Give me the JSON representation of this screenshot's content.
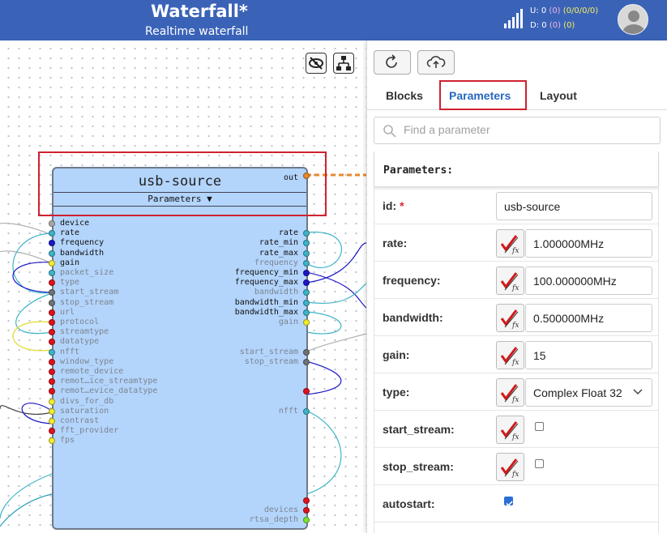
{
  "header": {
    "title": "Waterfall*",
    "subtitle": "Realtime waterfall",
    "stats_up": {
      "label": "U: 0",
      "paren": "(0)",
      "detail": "(0/0/0/0)"
    },
    "stats_down": {
      "label": "D: 0",
      "paren": "(0)",
      "detail": "(0)"
    }
  },
  "canvas": {
    "toolbar_icons": [
      "eye-slash-icon",
      "sitemap-icon"
    ],
    "block": {
      "title": "usb-source",
      "params_label": "Parameters ▼",
      "output_label": "out",
      "inputs": [
        {
          "label": "device",
          "color": "#a7a7a7",
          "state": "active"
        },
        {
          "label": "rate",
          "color": "#3eb3c6",
          "state": "active"
        },
        {
          "label": "frequency",
          "color": "#1b16c7",
          "state": "active"
        },
        {
          "label": "bandwidth",
          "color": "#3eb3c6",
          "state": "active"
        },
        {
          "label": "gain",
          "color": "#f2ec2e",
          "state": "active"
        },
        {
          "label": "packet_size",
          "color": "#3eb3c6",
          "state": "dim"
        },
        {
          "label": "type",
          "color": "#e0121d",
          "state": "dim"
        },
        {
          "label": "start_stream",
          "color": "#6e7274",
          "state": "dim"
        },
        {
          "label": "stop_stream",
          "color": "#6e7274",
          "state": "dim"
        },
        {
          "label": "url",
          "color": "#e0121d",
          "state": "dim"
        },
        {
          "label": "protocol",
          "color": "#e0121d",
          "state": "dim"
        },
        {
          "label": "streamtype",
          "color": "#e0121d",
          "state": "dim"
        },
        {
          "label": "datatype",
          "color": "#e0121d",
          "state": "dim"
        },
        {
          "label": "nfft",
          "color": "#3eb3c6",
          "state": "dim"
        },
        {
          "label": "window_type",
          "color": "#e0121d",
          "state": "dim"
        },
        {
          "label": "remote_device",
          "color": "#e0121d",
          "state": "dim"
        },
        {
          "label": "remot…ice_streamtype",
          "color": "#e0121d",
          "state": "dim"
        },
        {
          "label": "remot…evice_datatype",
          "color": "#e0121d",
          "state": "dim"
        },
        {
          "label": "divs_for_db",
          "color": "#f2ec2e",
          "state": "dim"
        },
        {
          "label": "saturation",
          "color": "#f2ec2e",
          "state": "dim"
        },
        {
          "label": "contrast",
          "color": "#f2ec2e",
          "state": "dim"
        },
        {
          "label": "fft_provider",
          "color": "#e0121d",
          "state": "dim"
        },
        {
          "label": "fps",
          "color": "#f2ec2e",
          "state": "dim"
        }
      ],
      "outputs": [
        {
          "label": "rate",
          "color": "#3eb3c6",
          "state": "active",
          "row": 1
        },
        {
          "label": "rate_min",
          "color": "#3eb3c6",
          "state": "active",
          "row": 2
        },
        {
          "label": "rate_max",
          "color": "#3eb3c6",
          "state": "active",
          "row": 3
        },
        {
          "label": "frequency",
          "color": "#3eb3c6",
          "state": "dim",
          "row": 4
        },
        {
          "label": "frequency_min",
          "color": "#1b16c7",
          "state": "active",
          "row": 5
        },
        {
          "label": "frequency_max",
          "color": "#1b16c7",
          "state": "active",
          "row": 6
        },
        {
          "label": "bandwidth",
          "color": "#3eb3c6",
          "state": "dim",
          "row": 7
        },
        {
          "label": "bandwidth_min",
          "color": "#3eb3c6",
          "state": "active",
          "row": 8
        },
        {
          "label": "bandwidth_max",
          "color": "#3eb3c6",
          "state": "active",
          "row": 9
        },
        {
          "label": "gain",
          "color": "#f2ec2e",
          "state": "dim",
          "row": 10
        },
        {
          "label": "start_stream",
          "color": "#6e7274",
          "state": "dim",
          "row": 13
        },
        {
          "label": "stop_stream",
          "color": "#6e7274",
          "state": "dim",
          "row": 14
        },
        {
          "label": "",
          "color": "#e0121d",
          "state": "dim",
          "row": 17
        },
        {
          "label": "nfft",
          "color": "#3eb3c6",
          "state": "dim",
          "row": 19
        },
        {
          "label": "",
          "color": "#e0121d",
          "state": "dim",
          "row": 28
        },
        {
          "label": "devices",
          "color": "#e0121d",
          "state": "dim",
          "row": 29
        },
        {
          "label": "rtsa_depth",
          "color": "#7be52c",
          "state": "dim",
          "row": 30
        }
      ]
    }
  },
  "panel": {
    "toolbar_icons": [
      "undo-icon",
      "cloud-upload-icon"
    ],
    "tabs": [
      {
        "label": "Blocks",
        "active": false
      },
      {
        "label": "Parameters",
        "active": true
      },
      {
        "label": "Layout",
        "active": false
      }
    ],
    "search": {
      "placeholder": "Find a parameter",
      "value": ""
    },
    "section_title": "Parameters:",
    "params": [
      {
        "label": "id:",
        "required": "*",
        "value": "usb-source",
        "kind": "text",
        "fx": false
      },
      {
        "label": "rate:",
        "value": "1.000000MHz",
        "kind": "text",
        "fx": true
      },
      {
        "label": "frequency:",
        "value": "100.000000MHz",
        "kind": "text",
        "fx": true
      },
      {
        "label": "bandwidth:",
        "value": "0.500000MHz",
        "kind": "text",
        "fx": true
      },
      {
        "label": "gain:",
        "value": "15",
        "kind": "text",
        "fx": true
      },
      {
        "label": "type:",
        "value": "Complex Float 32",
        "kind": "select",
        "fx": true
      },
      {
        "label": "start_stream:",
        "checked": false,
        "kind": "checkbox",
        "fx": true
      },
      {
        "label": "stop_stream:",
        "checked": false,
        "kind": "checkbox",
        "fx": true
      },
      {
        "label": "autostart:",
        "checked": true,
        "kind": "checkbox",
        "fx": false
      }
    ]
  }
}
